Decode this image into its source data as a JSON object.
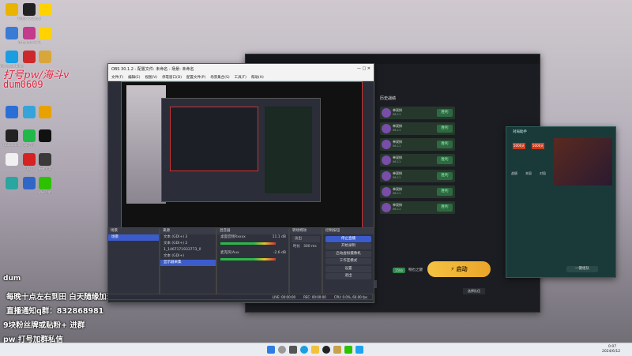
{
  "desktop_icons": [
    {
      "label": "",
      "color": "#e8b400"
    },
    {
      "label": "Tiktok & Douyin Windows...",
      "color": "#222"
    },
    {
      "label": "",
      "color": "#ffd200"
    },
    {
      "label": "",
      "color": "#3a7bd5"
    },
    {
      "label": "Instagram & Facebook",
      "color": "#c23b8c"
    },
    {
      "label": "",
      "color": "#ffd200"
    },
    {
      "label": "Microsoft Edge",
      "color": "#1b9de2"
    },
    {
      "label": "",
      "color": "#cc2a2a"
    },
    {
      "label": "",
      "color": "#d9a63a"
    },
    {
      "label": "",
      "color": "#2b6fd6"
    },
    {
      "label": "",
      "color": "#36a3d9"
    },
    {
      "label": "",
      "color": "#e9a100"
    },
    {
      "label": "OBS Studio",
      "color": "#222"
    },
    {
      "label": "QQ音乐",
      "color": "#21b84a"
    },
    {
      "label": "",
      "color": "#111"
    },
    {
      "label": "",
      "color": "#f0f0f0"
    },
    {
      "label": "QQ",
      "color": "#d62222"
    },
    {
      "label": "新建文本",
      "color": "#3a3a3a"
    },
    {
      "label": "",
      "color": "#2aa6a0"
    },
    {
      "label": "",
      "color": "#3166c9"
    },
    {
      "label": "WeChat",
      "color": "#2dc100"
    }
  ],
  "overlay": {
    "red_line1": "打号pw/海斗v",
    "red_line2": "dum0609",
    "line_dum": "dum",
    "line1": "每晚十点左右到田  白天随缘加班",
    "line2": "直播通知q群：832868981",
    "line3": "9块粉丝牌或贴粉+      进群",
    "line4": "pw 打号加群私信"
  },
  "obs": {
    "title": "OBS 30.1.2 - 配置文件: 未命名 - 场景: 未命名",
    "menu": [
      "文件(F)",
      "编辑(E)",
      "视图(V)",
      "停靠窗口(D)",
      "配置文件(P)",
      "场景集合(S)",
      "工具(T)",
      "帮助(H)"
    ],
    "sourcebar": [
      "显示器采集",
      "设置",
      "滤镜",
      "显示器",
      "Q27G2G8B (2560x1440 @ 0,0)(主显示器)"
    ],
    "scenes_header": "场景",
    "scenes": [
      "场景"
    ],
    "sources_header": "来源",
    "sources": [
      "文本 (GDI+) 3",
      "文本 (GDI+) 2",
      "1_1467171933773_0",
      "文本 (GDI+)",
      "显示器采集"
    ],
    "mixer_header": "混音器",
    "mixer": [
      {
        "name": "桌面音频Rxxxx",
        "level": "11.1 dB"
      },
      {
        "name": "麦克风/Aux",
        "level": "-2.6 dB"
      }
    ],
    "transition_header": "转场特效",
    "transition": {
      "type": "淡出",
      "duration_label": "时长",
      "duration": "300 ms"
    },
    "controls_header": "控制按钮",
    "controls": [
      "停止直播",
      "开始录制",
      "启动虚拟摄像机",
      "工作室模式",
      "设置",
      "退出"
    ],
    "status": {
      "live": "LIVE: 00:00:00",
      "rec": "REC: 00:00:00",
      "cpu": "CPU: 0.0%, 60.00 fps"
    }
  },
  "client": {
    "history_title": "历史战绩",
    "matches": [
      {
        "name": "单双排",
        "sub": "06-11",
        "result": "胜利"
      },
      {
        "name": "单双排",
        "sub": "06-11",
        "result": "胜利"
      },
      {
        "name": "单双排",
        "sub": "06-11",
        "result": "胜利"
      },
      {
        "name": "单双排",
        "sub": "06-11",
        "result": "胜利"
      },
      {
        "name": "单双排",
        "sub": "06-11",
        "result": "胜利"
      },
      {
        "name": "单双排",
        "sub": "06-11",
        "result": "胜利"
      },
      {
        "name": "单双排",
        "sub": "06-11",
        "result": "胜利"
      }
    ],
    "start_button": "⚡ 启动",
    "mode_badge": "15kb",
    "mode_text": "畅也之巅",
    "footer_btn": "选择队伍"
  },
  "helper": {
    "title": "对局助手",
    "tabs": [
      "战绩",
      "本局",
      "对局"
    ],
    "badges": [
      "5000天",
      "5000天"
    ],
    "button": "一键组队"
  },
  "taskbar": {
    "time": "0:07",
    "date": "2024/6/12"
  }
}
